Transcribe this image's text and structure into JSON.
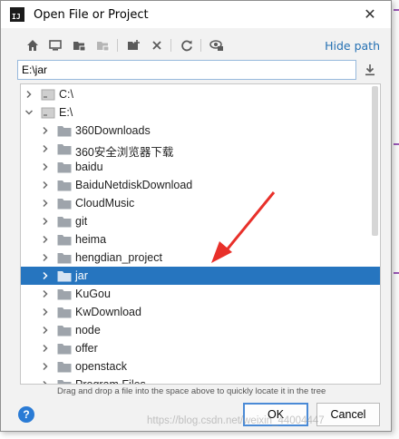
{
  "window": {
    "title": "Open File or Project",
    "app_icon_text": "IJ"
  },
  "toolbar": {
    "icons": [
      "home-icon",
      "desktop-icon",
      "project-folder-icon",
      "module-folder-icon",
      "new-folder-icon",
      "delete-icon",
      "refresh-icon",
      "show-hidden-icon"
    ],
    "hide_path_label": "Hide path"
  },
  "path": {
    "value": "E:\\jar"
  },
  "tree": {
    "items": [
      {
        "label": "C:\\",
        "expanded": false,
        "level": 0,
        "drive": true
      },
      {
        "label": "E:\\",
        "expanded": true,
        "level": 0,
        "drive": true
      },
      {
        "label": "360Downloads",
        "level": 1
      },
      {
        "label": "360安全浏览器下载",
        "level": 1
      },
      {
        "label": "baidu",
        "level": 1
      },
      {
        "label": "BaiduNetdiskDownload",
        "level": 1
      },
      {
        "label": "CloudMusic",
        "level": 1
      },
      {
        "label": "git",
        "level": 1
      },
      {
        "label": "heima",
        "level": 1
      },
      {
        "label": "hengdian_project",
        "level": 1
      },
      {
        "label": "jar",
        "level": 1,
        "selected": true
      },
      {
        "label": "KuGou",
        "level": 1
      },
      {
        "label": "KwDownload",
        "level": 1
      },
      {
        "label": "node",
        "level": 1
      },
      {
        "label": "offer",
        "level": 1
      },
      {
        "label": "openstack",
        "level": 1
      },
      {
        "label": "Program Files",
        "level": 1
      }
    ]
  },
  "hint": "Drag and drop a file into the space above to quickly locate it in the tree",
  "buttons": {
    "help": "?",
    "ok": "OK",
    "cancel": "Cancel"
  },
  "watermark": "https://blog.csdn.net/weixin_44004447",
  "colors": {
    "accent": "#2675bf",
    "link": "#2470b3",
    "annotation_arrow": "#e8302a"
  }
}
